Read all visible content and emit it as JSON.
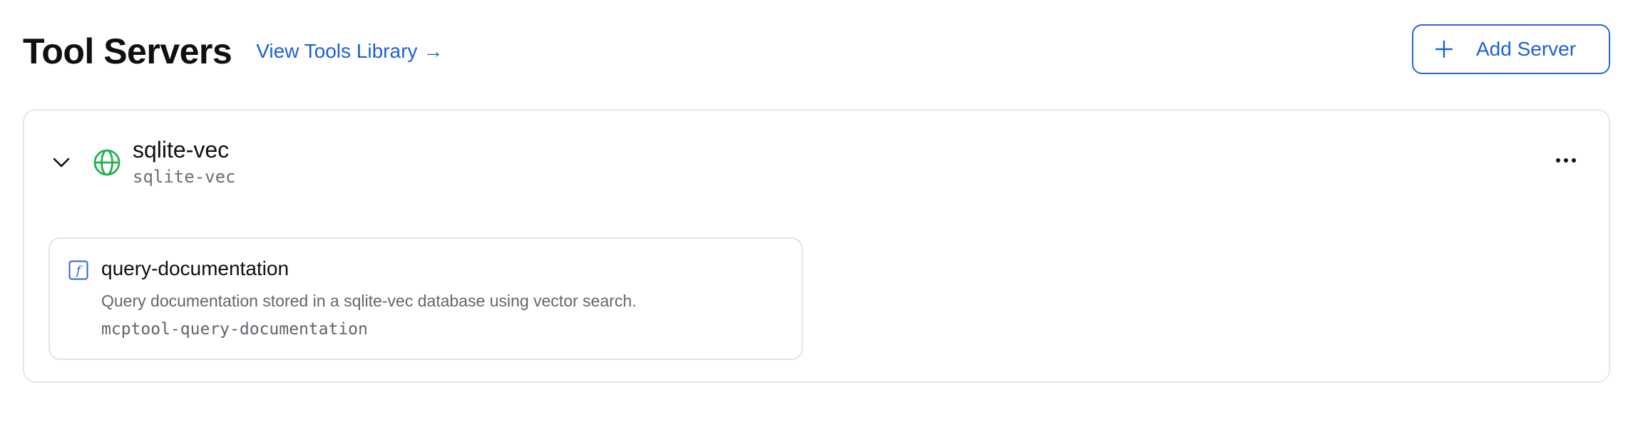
{
  "header": {
    "title": "Tool Servers",
    "library_link": "View Tools Library",
    "library_arrow": "→",
    "add_button": "Add Server"
  },
  "server": {
    "name": "sqlite-vec",
    "id": "sqlite-vec",
    "icon": "globe-icon",
    "status_color": "#22b24c"
  },
  "tools": [
    {
      "name": "query-documentation",
      "description": "Query documentation stored in a sqlite-vec database using vector search.",
      "id": "mcptool-query-documentation",
      "icon": "function-icon"
    }
  ],
  "colors": {
    "accent": "#1f5fd6",
    "border": "#e7e7ea"
  }
}
